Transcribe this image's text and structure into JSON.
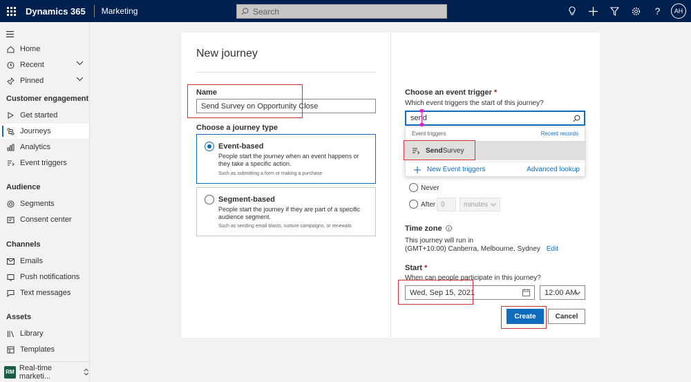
{
  "topbar": {
    "app_name": "Dynamics 365",
    "area_name": "Marketing",
    "search_placeholder": "Search",
    "avatar_initials": "AH",
    "icons": [
      "lightbulb-icon",
      "plus-icon",
      "filter-icon",
      "gear-icon",
      "help-icon"
    ]
  },
  "sidebar": {
    "items_top": [
      {
        "label": "Home",
        "icon": "home-icon"
      },
      {
        "label": "Recent",
        "icon": "clock-icon"
      },
      {
        "label": "Pinned",
        "icon": "pin-icon"
      }
    ],
    "sections": [
      {
        "title": "Customer engagement",
        "items": [
          {
            "label": "Get started",
            "icon": "play-icon"
          },
          {
            "label": "Journeys",
            "icon": "journey-icon",
            "active": true
          },
          {
            "label": "Analytics",
            "icon": "analytics-icon"
          },
          {
            "label": "Event triggers",
            "icon": "trigger-icon"
          }
        ]
      },
      {
        "title": "Audience",
        "items": [
          {
            "label": "Segments",
            "icon": "segments-icon"
          },
          {
            "label": "Consent center",
            "icon": "consent-icon"
          }
        ]
      },
      {
        "title": "Channels",
        "items": [
          {
            "label": "Emails",
            "icon": "mail-icon"
          },
          {
            "label": "Push notifications",
            "icon": "phone-icon"
          },
          {
            "label": "Text messages",
            "icon": "chat-icon"
          }
        ]
      },
      {
        "title": "Assets",
        "items": [
          {
            "label": "Library",
            "icon": "library-icon"
          },
          {
            "label": "Templates",
            "icon": "template-icon"
          }
        ]
      }
    ],
    "area_switcher": {
      "badge": "RM",
      "label": "Real-time marketi..."
    }
  },
  "dialog": {
    "title": "New journey",
    "name_label": "Name",
    "name_value": "Send Survey on Opportunity Close",
    "type_label": "Choose a journey type",
    "types": [
      {
        "title": "Event-based",
        "description": "People start the journey when an event happens or they take a specific action.",
        "example": "Such as submitting a form or making a purchase",
        "selected": true
      },
      {
        "title": "Segment-based",
        "description": "People start the journey if they are part of a specific audience segment.",
        "example": "Such as sending email blasts, nurture campaigns, or renewals",
        "selected": false
      }
    ],
    "trigger": {
      "label": "Choose an event trigger",
      "required_mark": "*",
      "question": "Which event triggers the start of this journey?",
      "search_value": "send",
      "dropdown_header": "Event triggers",
      "dropdown_recent": "Recent records",
      "result_prefix": "Send",
      "result_suffix": " Survey",
      "new_label": "New Event triggers",
      "advanced_label": "Advanced lookup"
    },
    "repeat": {
      "never_label": "Never",
      "after_label": "After",
      "after_value": "0",
      "unit_value": "minutes"
    },
    "timezone": {
      "label": "Time zone",
      "line1": "This journey will run in",
      "value": "(GMT+10:00) Canberra, Melbourne, Sydney",
      "edit_label": "Edit"
    },
    "start": {
      "label": "Start",
      "required_mark": "*",
      "question": "When can people participate in this journey?",
      "date_value": "Wed, Sep 15, 2021",
      "time_value": "12:00 AM"
    },
    "buttons": {
      "create": "Create",
      "cancel": "Cancel"
    }
  },
  "colors": {
    "topbar": "#002050",
    "accent": "#0f6cbd",
    "highlight": "#d13438",
    "cursor_marker": "#e81ec4"
  }
}
